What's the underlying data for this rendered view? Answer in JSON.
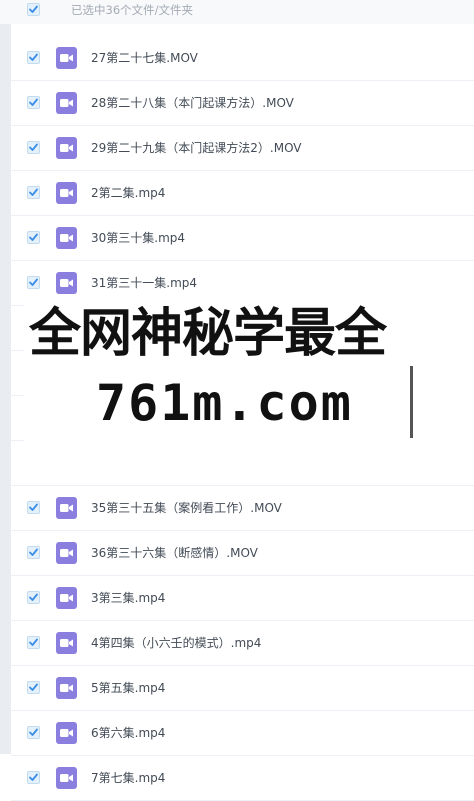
{
  "header": {
    "selected_text": "已选中36个文件/文件夹",
    "checked": true
  },
  "files_top": [
    {
      "name": "27第二十七集.MOV",
      "checked": true,
      "icon": "video-file-icon"
    },
    {
      "name": "28第二十八集（本门起课方法）.MOV",
      "checked": true,
      "icon": "video-file-icon"
    },
    {
      "name": "29第二十九集（本门起课方法2）.MOV",
      "checked": true,
      "icon": "video-file-icon"
    },
    {
      "name": "2第二集.mp4",
      "checked": true,
      "icon": "video-file-icon"
    },
    {
      "name": "30第三十集.mp4",
      "checked": true,
      "icon": "video-file-icon"
    },
    {
      "name": "31第三十一集.mp4",
      "checked": true,
      "icon": "video-file-icon"
    }
  ],
  "files_bottom": [
    {
      "name": "35第三十五集（案例看工作）.MOV",
      "checked": true,
      "icon": "video-file-icon"
    },
    {
      "name": "36第三十六集（断感情）.MOV",
      "checked": true,
      "icon": "video-file-icon"
    },
    {
      "name": "3第三集.mp4",
      "checked": true,
      "icon": "video-file-icon"
    },
    {
      "name": "4第四集（小六壬的模式）.mp4",
      "checked": true,
      "icon": "video-file-icon"
    },
    {
      "name": "5第五集.mp4",
      "checked": true,
      "icon": "video-file-icon"
    },
    {
      "name": "6第六集.mp4",
      "checked": true,
      "icon": "video-file-icon"
    },
    {
      "name": "7第七集.mp4",
      "checked": true,
      "icon": "video-file-icon"
    }
  ],
  "watermark": {
    "line1": "全网神秘学最全",
    "line2": "761m.com"
  },
  "colors": {
    "icon_bg": "#8a7fde",
    "check": "#3a8ee6",
    "header_text": "#a4abb5"
  }
}
